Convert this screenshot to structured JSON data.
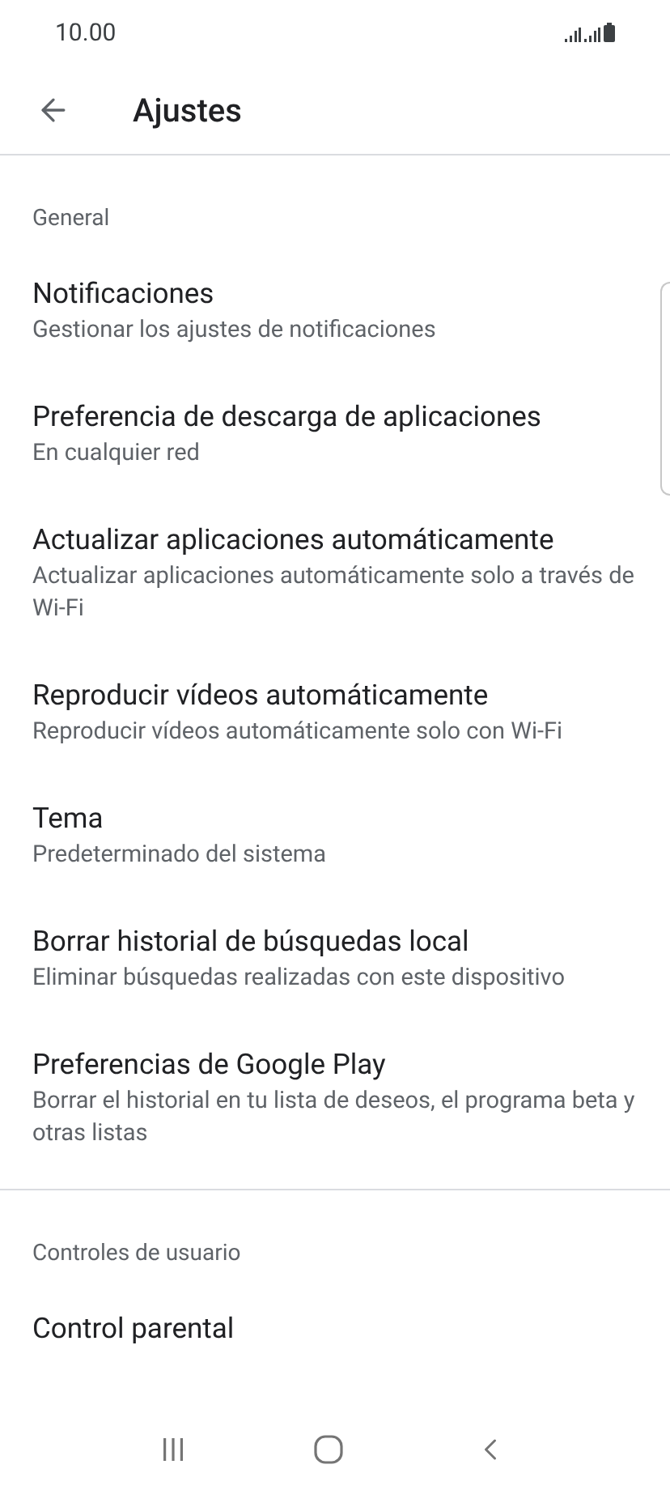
{
  "status_bar": {
    "time": "10.00"
  },
  "header": {
    "title": "Ajustes"
  },
  "sections": [
    {
      "title": "General",
      "items": [
        {
          "title": "Notificaciones",
          "subtitle": "Gestionar los ajustes de notificaciones"
        },
        {
          "title": "Preferencia de descarga de aplicaciones",
          "subtitle": "En cualquier red"
        },
        {
          "title": "Actualizar aplicaciones automáticamente",
          "subtitle": "Actualizar aplicaciones automáticamente solo a través de Wi-Fi"
        },
        {
          "title": "Reproducir vídeos automáticamente",
          "subtitle": "Reproducir vídeos automáticamente solo con Wi-Fi"
        },
        {
          "title": "Tema",
          "subtitle": "Predeterminado del sistema"
        },
        {
          "title": "Borrar historial de búsquedas local",
          "subtitle": "Eliminar búsquedas realizadas con este dispositivo"
        },
        {
          "title": "Preferencias de Google Play",
          "subtitle": "Borrar el historial en tu lista de deseos, el programa beta y otras listas"
        }
      ]
    },
    {
      "title": "Controles de usuario",
      "items": [
        {
          "title": "Control parental"
        }
      ]
    }
  ]
}
